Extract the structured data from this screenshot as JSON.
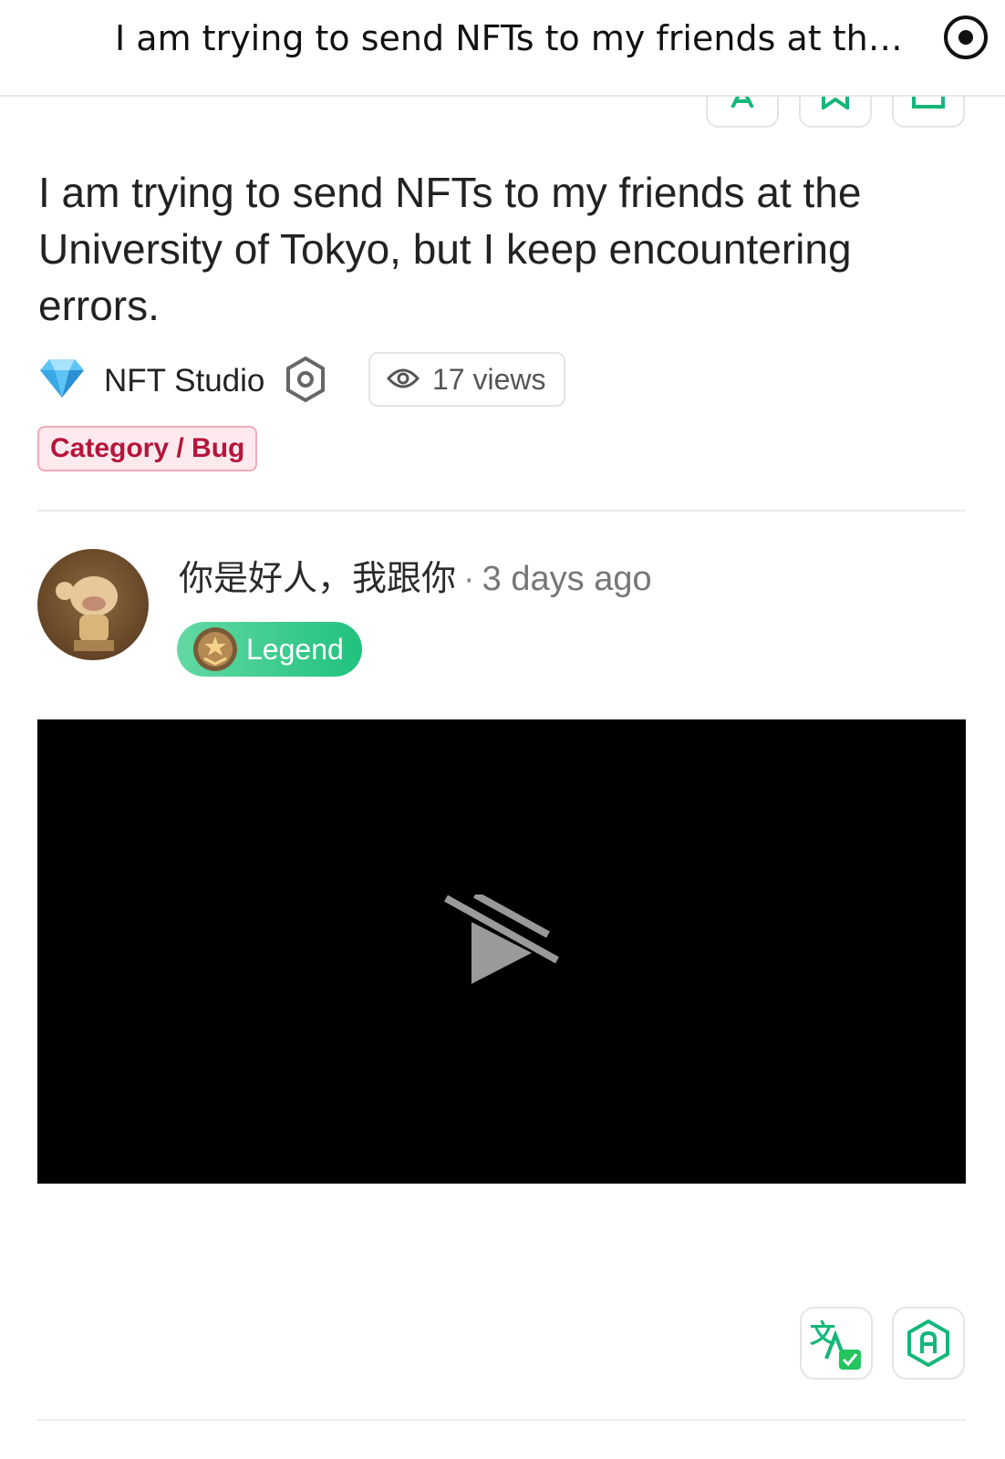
{
  "header": {
    "title": "I am trying to send NFTs to my friends at the University of Tokyo, but I keep encountering errors."
  },
  "question": {
    "text": "I am trying to send NFTs to my friends at the University of Tokyo, but I keep encountering errors.",
    "source": "NFT Studio",
    "views": "17 views",
    "category": "Category / Bug"
  },
  "comment": {
    "author": "你是好人，我跟你",
    "separator": "·",
    "time": "3 days ago",
    "badge": "Legend"
  },
  "icons": {
    "record": "record-icon",
    "diamond": "diamond-icon",
    "gear": "settings-hex-icon",
    "eye": "eye-icon",
    "play": "video-unavailable-icon",
    "translate": "translate-icon",
    "ai": "ai-hexagon-icon"
  },
  "colors": {
    "accent": "#20c27d",
    "category_text": "#b5153b",
    "category_bg": "#fde9ee"
  }
}
